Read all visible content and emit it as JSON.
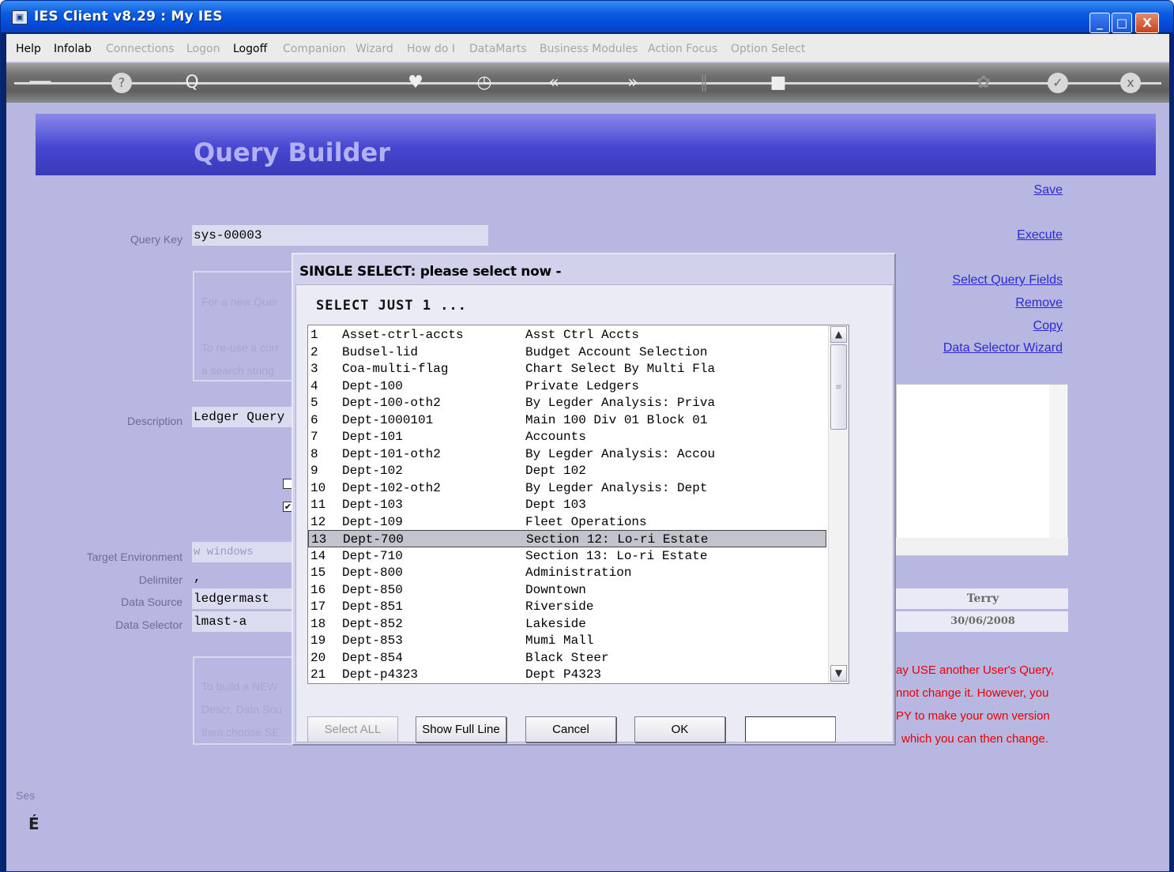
{
  "window": {
    "title": "IES Client v8.29 : My IES",
    "min_glyph": "_",
    "max_glyph": "□",
    "close_glyph": "X"
  },
  "menu": [
    {
      "label": "Help",
      "enabled": true
    },
    {
      "label": "Infolab",
      "enabled": true
    },
    {
      "label": "Connections",
      "enabled": false
    },
    {
      "label": "Logon",
      "enabled": false
    },
    {
      "label": "Logoff",
      "enabled": true
    },
    {
      "label": "Companion",
      "enabled": false
    },
    {
      "label": "Wizard",
      "enabled": false
    },
    {
      "label": "How do I",
      "enabled": false
    },
    {
      "label": "DataMarts",
      "enabled": false
    },
    {
      "label": "Business Modules",
      "enabled": false
    },
    {
      "label": "Action Focus",
      "enabled": false
    },
    {
      "label": "Option Select",
      "enabled": false
    }
  ],
  "toolbar": {
    "icons": [
      "key-icon",
      "help-icon",
      "search-icon",
      "heart-icon",
      "clock-icon",
      "back-icon",
      "forward-icon",
      "tree-icon",
      "stop-icon",
      "tools-icon",
      "check-icon",
      "close-icon"
    ],
    "glyphs": {
      "key": "──",
      "help": "?",
      "search": "Q",
      "heart": "♥",
      "clock": "◷",
      "back": "«",
      "forward": "»",
      "tree": "∥",
      "stop": "■",
      "tools": "✿",
      "check": "✓",
      "close": "x"
    }
  },
  "banner": {
    "title": "Query Builder"
  },
  "links": {
    "save": "Save",
    "execute": "Execute",
    "select_query_fields": "Select Query Fields",
    "remove": "Remove",
    "copy": "Copy",
    "data_selector_wizard": "Data Selector Wizard"
  },
  "form": {
    "query_key_label": "Query Key",
    "query_key_value": "sys-00003",
    "hint1": "For a new Quer",
    "hint2": "To re-use a curr",
    "hint3": "a search string",
    "description_label": "Description",
    "description_value": "Ledger Query",
    "target_env_label": "Target Environment",
    "target_env_value": "w   windows",
    "delimiter_label": "Delimiter",
    "delimiter_value": ",",
    "data_source_label": "Data Source",
    "data_source_value": "ledgermast",
    "data_selector_label": "Data Selector",
    "data_selector_value": "lmast-a",
    "owner_value": "Terry",
    "date_value": "30/06/2008",
    "hint4": "To build a NEW",
    "hint5": "Descr, Data Sou",
    "hint6": "then choose SE"
  },
  "notice": {
    "line1": "ay USE another User's Query,",
    "line2": "nnot change it. However, you",
    "line3": "PY to make your own version",
    "line4": "which you can then change."
  },
  "status": {
    "s": "Ses",
    "e": "É"
  },
  "dialog": {
    "title": "SINGLE SELECT: please select now -",
    "prompt": "SELECT JUST 1 ...",
    "selected_index": 12,
    "rows": [
      {
        "n": "1",
        "key": "Asset-ctrl-accts",
        "desc": "Asst Ctrl Accts"
      },
      {
        "n": "2",
        "key": "Budsel-lid",
        "desc": "Budget Account Selection"
      },
      {
        "n": "3",
        "key": "Coa-multi-flag",
        "desc": "Chart Select By Multi Fla"
      },
      {
        "n": "4",
        "key": "Dept-100",
        "desc": "Private Ledgers"
      },
      {
        "n": "5",
        "key": "Dept-100-oth2",
        "desc": "By Legder Analysis: Priva"
      },
      {
        "n": "6",
        "key": "Dept-1000101",
        "desc": "Main 100 Div 01 Block 01"
      },
      {
        "n": "7",
        "key": "Dept-101",
        "desc": "Accounts"
      },
      {
        "n": "8",
        "key": "Dept-101-oth2",
        "desc": "By Legder Analysis: Accou"
      },
      {
        "n": "9",
        "key": "Dept-102",
        "desc": "Dept 102"
      },
      {
        "n": "10",
        "key": "Dept-102-oth2",
        "desc": "By Legder Analysis: Dept"
      },
      {
        "n": "11",
        "key": "Dept-103",
        "desc": "Dept 103"
      },
      {
        "n": "12",
        "key": "Dept-109",
        "desc": "Fleet Operations"
      },
      {
        "n": "13",
        "key": "Dept-700",
        "desc": "Section 12: Lo-ri Estate"
      },
      {
        "n": "14",
        "key": "Dept-710",
        "desc": "Section 13: Lo-ri Estate"
      },
      {
        "n": "15",
        "key": "Dept-800",
        "desc": "Administration"
      },
      {
        "n": "16",
        "key": "Dept-850",
        "desc": "Downtown"
      },
      {
        "n": "17",
        "key": "Dept-851",
        "desc": "Riverside"
      },
      {
        "n": "18",
        "key": "Dept-852",
        "desc": "Lakeside"
      },
      {
        "n": "19",
        "key": "Dept-853",
        "desc": "Mumi Mall"
      },
      {
        "n": "20",
        "key": "Dept-854",
        "desc": "Black Steer"
      },
      {
        "n": "21",
        "key": "Dept-p4323",
        "desc": "Dept P4323"
      }
    ],
    "buttons": {
      "select_all": "Select ALL",
      "show_full_line": "Show Full Line",
      "cancel": "Cancel",
      "ok": "OK"
    },
    "input_value": ""
  }
}
